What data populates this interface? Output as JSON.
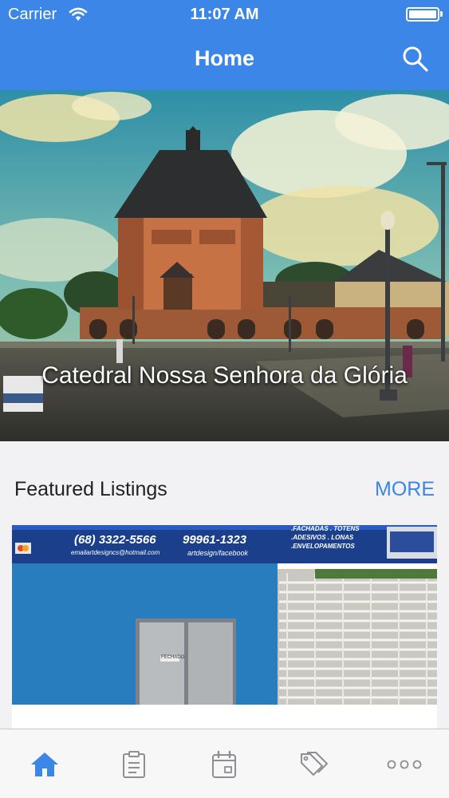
{
  "status_bar": {
    "carrier": "Carrier",
    "time": "11:07 AM"
  },
  "nav": {
    "title": "Home",
    "search_icon": "search-icon"
  },
  "hero": {
    "caption": "Catedral Nossa Senhora da Glória"
  },
  "featured": {
    "title": "Featured Listings",
    "more_label": "MORE",
    "listing": {
      "sign": {
        "phone1": "(68) 3322-5566",
        "phone2": "99961-1323",
        "email": "emailartdesigncs@hotmail.com",
        "facebook": "artdesign/facebook",
        "services": [
          ".FACHADAS . TOTENS",
          ".ADESIVOS . LONAS",
          ".ENVELOPAMENTOS"
        ],
        "door_label": "FECHADO"
      }
    }
  },
  "tab_bar": {
    "tabs": [
      {
        "icon": "home-icon",
        "active": true
      },
      {
        "icon": "clipboard-icon",
        "active": false
      },
      {
        "icon": "calendar-icon",
        "active": false
      },
      {
        "icon": "tag-icon",
        "active": false
      },
      {
        "icon": "more-icon",
        "active": false
      }
    ]
  },
  "colors": {
    "accent": "#3b86e6",
    "inactive_icon": "#8e8e93"
  }
}
